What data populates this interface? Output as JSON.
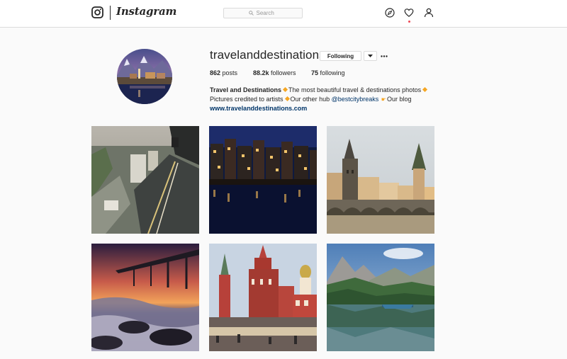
{
  "header": {
    "app_name": "Instagram",
    "search_placeholder": "Search",
    "icons": [
      "instagram-glyph-icon",
      "compass-icon",
      "heart-icon",
      "person-icon"
    ]
  },
  "profile": {
    "username": "travelanddestinations",
    "follow_button_label": "Following",
    "stats": {
      "posts_count": "862",
      "posts_label": "posts",
      "followers_count": "88.2k",
      "followers_label": "followers",
      "following_count": "75",
      "following_label": "following"
    },
    "bio": {
      "name": "Travel and Destinations",
      "line1_text": "The most beautiful travel & destinations photos",
      "line2_part1": "Pictures credited to artists",
      "line2_part2": "Our other hub",
      "line2_mention": "@bestcitybreaks",
      "line2_part3": "Our blog",
      "website": "www.travelanddestinations.com"
    }
  },
  "posts": [
    {
      "subject": "rooftop city view",
      "caption": ""
    },
    {
      "subject": "amsterdam canal houses at night",
      "caption": ""
    },
    {
      "subject": "prague charles bridge",
      "caption": ""
    },
    {
      "subject": "pier at sunset with waves",
      "caption": ""
    },
    {
      "subject": "moscow red square",
      "caption": ""
    },
    {
      "subject": "alpine lake with boat",
      "caption": ""
    }
  ],
  "colors": {
    "accent_link": "#003569",
    "notification_dot": "#ed4956",
    "emoji_orange": "#f5a623",
    "border": "#dbdbdb",
    "background": "#fafafa"
  }
}
